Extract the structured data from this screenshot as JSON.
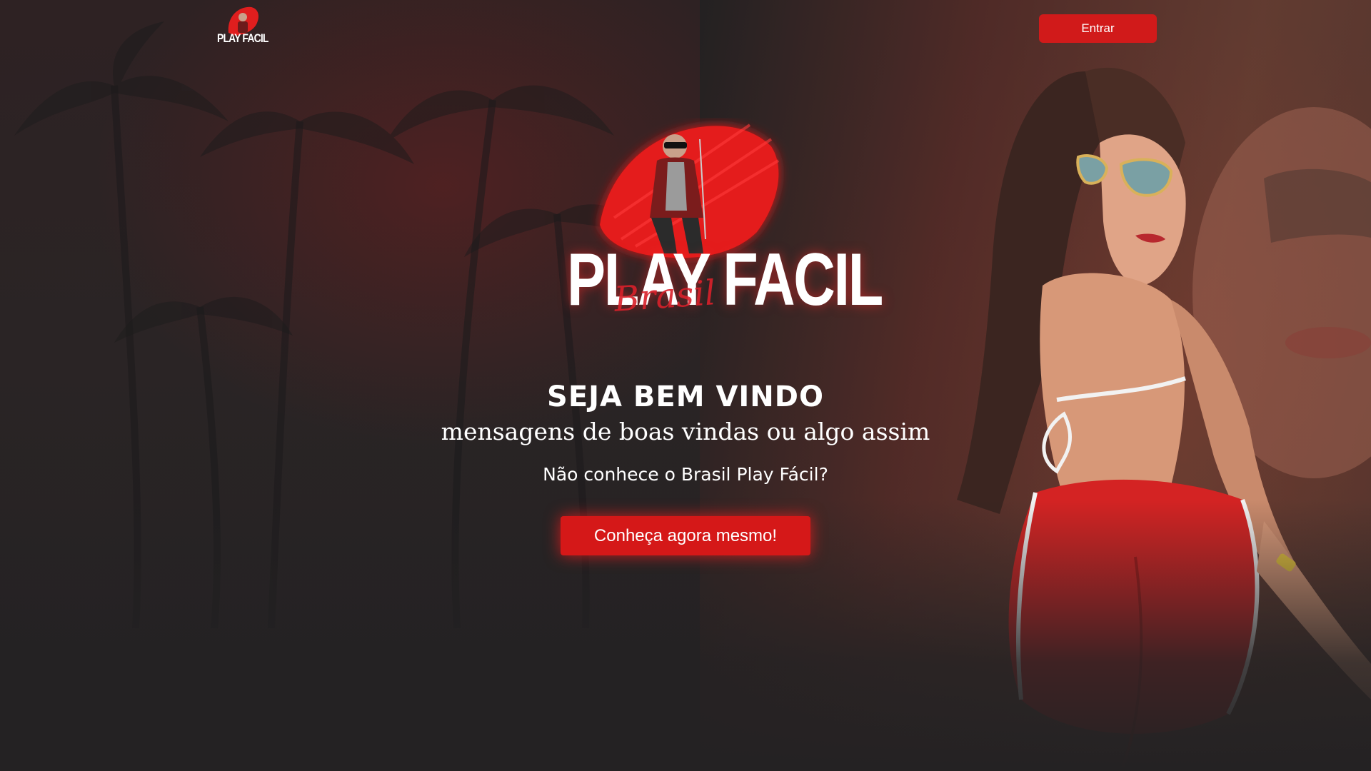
{
  "header": {
    "logo_text": "PLAY FACIL",
    "login_label": "Entrar"
  },
  "hero": {
    "logo_text": "PLAY FACIL",
    "logo_script": "Brasil",
    "title": "SEJA BEM VINDO",
    "subtitle": "mensagens de boas vindas ou algo assim",
    "question": "Não conhece o Brasil Play Fácil?",
    "cta_label": "Conheça agora mesmo!"
  },
  "colors": {
    "accent": "#d51818",
    "background": "#242223",
    "text": "#ffffff"
  },
  "icons": {
    "header_logo": "play-facil-logo-icon",
    "hero_logo": "play-facil-brasil-logo-icon"
  }
}
